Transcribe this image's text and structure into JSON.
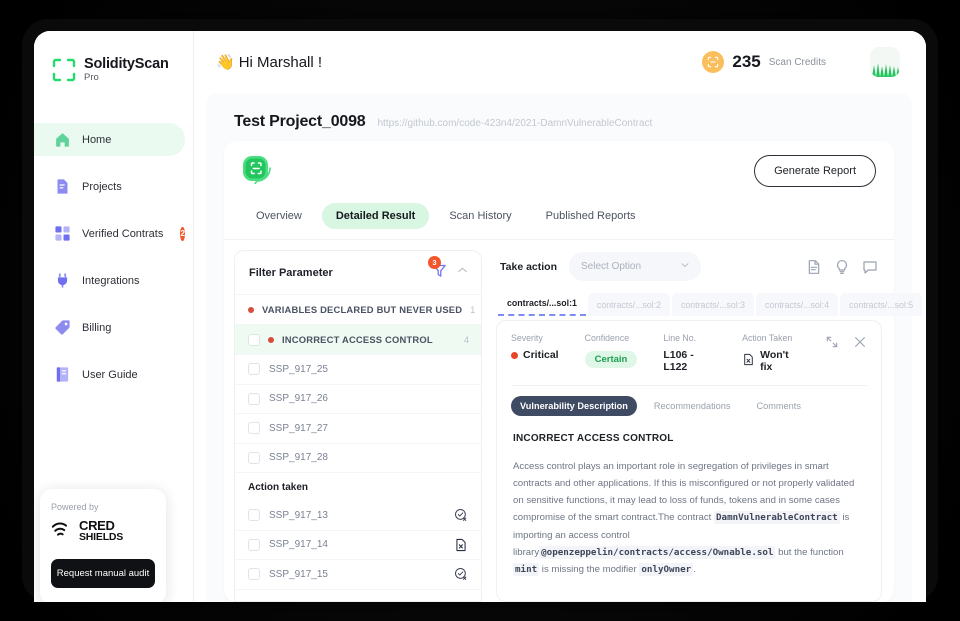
{
  "brand": {
    "title": "SolidityScan",
    "subtitle": "Pro",
    "icon": "scan-frame-icon"
  },
  "sidebar": {
    "items": [
      {
        "label": "Home",
        "icon": "home-icon",
        "active": true,
        "badge": ""
      },
      {
        "label": "Projects",
        "icon": "projects-icon",
        "active": false,
        "badge": ""
      },
      {
        "label": "Verified Contrats",
        "icon": "verified-contracts-icon",
        "active": false,
        "badge": "2"
      },
      {
        "label": "Integrations",
        "icon": "integrations-plug-icon",
        "active": false,
        "badge": ""
      },
      {
        "label": "Billing",
        "icon": "billing-tag-icon",
        "active": false,
        "badge": ""
      },
      {
        "label": "User Guide",
        "icon": "user-guide-book-icon",
        "active": false,
        "badge": ""
      }
    ],
    "powered": {
      "label": "Powered by",
      "brand_top": "CRED",
      "brand_bottom": "SHIELDS",
      "button": "Request manual audit"
    }
  },
  "topbar": {
    "greeting": "Hi Marshall !",
    "greeting_emoji": "👋",
    "credits_value": "235",
    "credits_label": "Scan Credits",
    "credits_icon": "scan-coin-icon",
    "avatar": "user-avatar"
  },
  "project": {
    "title": "Test Project_0098",
    "url": "https://github.com/code-423n4/2021-DamnVulnerableContract"
  },
  "card": {
    "scan_icon": "rescan-icon",
    "generate_report": "Generate Report",
    "tabs": [
      {
        "label": "Overview",
        "active": false
      },
      {
        "label": "Detailed Result",
        "active": true
      },
      {
        "label": "Scan History",
        "active": false
      },
      {
        "label": "Published Reports",
        "active": false
      }
    ]
  },
  "filter": {
    "title": "Filter Parameter",
    "badge": "3",
    "filter_icon": "funnel-icon",
    "collapse_icon": "chevron-up-icon",
    "categories": [
      {
        "label": "VARIABLES DECLARED BUT NEVER USED",
        "count": "1",
        "highlight": false,
        "checkbox": false
      },
      {
        "label": "INCORRECT ACCESS CONTROL",
        "count": "4",
        "highlight": true,
        "checkbox": true
      }
    ],
    "issues": [
      {
        "label": "SSP_917_25",
        "icon": ""
      },
      {
        "label": "SSP_917_26",
        "icon": ""
      },
      {
        "label": "SSP_917_27",
        "icon": ""
      },
      {
        "label": "SSP_917_28",
        "icon": ""
      }
    ],
    "group_title": "Action taken",
    "actioned": [
      {
        "label": "SSP_917_13",
        "icon": "wont-fix-icon"
      },
      {
        "label": "SSP_917_14",
        "icon": "false-positive-file-icon"
      },
      {
        "label": "SSP_917_15",
        "icon": "wont-fix-icon"
      }
    ]
  },
  "detail": {
    "action_label": "Take action",
    "select_placeholder": "Select Option",
    "bar_icons": [
      "file-icon",
      "bulb-icon",
      "comment-icon"
    ],
    "file_tabs": [
      {
        "label": "contracts/...sol:1",
        "active": true
      },
      {
        "label": "contracts/...sol:2",
        "active": false
      },
      {
        "label": "contracts/...sol:3",
        "active": false
      },
      {
        "label": "contracts/...sol:4",
        "active": false
      },
      {
        "label": "contracts/...sol:5",
        "active": false
      }
    ],
    "meta": {
      "severity_label": "Severity",
      "severity_value": "Critical",
      "confidence_label": "Confidence",
      "confidence_value": "Certain",
      "line_label": "Line No.",
      "line_value": "L106 - L122",
      "action_taken_label": "Action Taken",
      "action_taken_value": "Won't fix",
      "expand_icon": "expand-arrows-icon",
      "close_icon": "close-icon"
    },
    "sub_tabs": [
      {
        "label": "Vulnerability Description",
        "active": true
      },
      {
        "label": "Recommendations",
        "active": false
      },
      {
        "label": "Comments",
        "active": false
      }
    ],
    "vuln_title": "INCORRECT ACCESS CONTROL",
    "description_parts": [
      {
        "t": "Access control plays an important role in segregation of privileges in smart contracts and other applications. If this is misconfigured or not properly validated on sensitive functions, it may lead to loss of funds, tokens and in some cases compromise of the smart contract.The contract ",
        "code": false
      },
      {
        "t": "DamnVulnerableContract",
        "code": true
      },
      {
        "t": " is importing an access control library",
        "code": false
      },
      {
        "t": "@openzeppelin/contracts/access/Ownable.sol",
        "code": true
      },
      {
        "t": " but the function ",
        "code": false
      },
      {
        "t": "mint",
        "code": true
      },
      {
        "t": " is missing the modifier ",
        "code": false
      },
      {
        "t": "onlyOwner",
        "code": true
      },
      {
        "t": ".",
        "code": false
      }
    ]
  },
  "colors": {
    "accent_green": "#22c55e",
    "pill_green_bg": "#d9f6e2",
    "badge_red": "#f4552a",
    "critical_red": "#e8442a",
    "dark_pill": "#3f4a63"
  }
}
